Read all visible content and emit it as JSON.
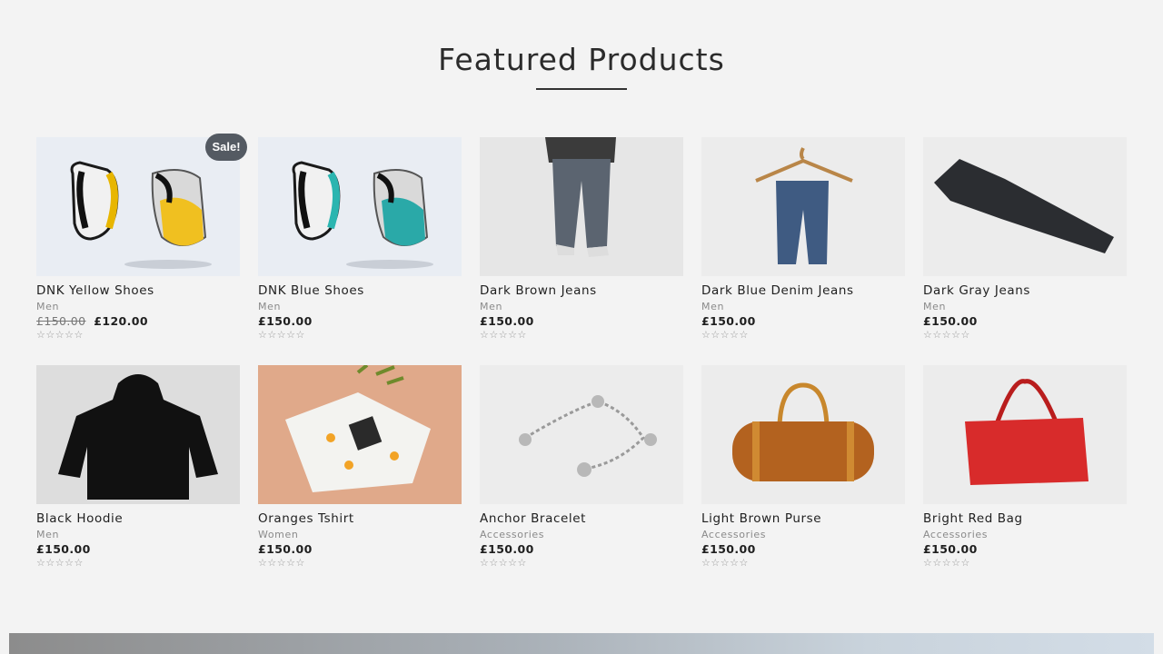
{
  "section": {
    "title": "Featured Products"
  },
  "products": [
    {
      "name": "DNK Yellow Shoes",
      "category": "Men",
      "price": "£120.00",
      "old_price": "£150.00",
      "badge": "Sale!",
      "stars": "☆☆☆☆☆",
      "image": "yellow-shoes-image"
    },
    {
      "name": "DNK Blue Shoes",
      "category": "Men",
      "price": "£150.00",
      "stars": "☆☆☆☆☆",
      "image": "blue-shoes-image"
    },
    {
      "name": "Dark Brown Jeans",
      "category": "Men",
      "price": "£150.00",
      "stars": "☆☆☆☆☆",
      "image": "brown-jeans-image"
    },
    {
      "name": "Dark Blue Denim Jeans",
      "category": "Men",
      "price": "£150.00",
      "stars": "☆☆☆☆☆",
      "image": "denim-jeans-image"
    },
    {
      "name": "Dark Gray Jeans",
      "category": "Men",
      "price": "£150.00",
      "stars": "☆☆☆☆☆",
      "image": "gray-jeans-image"
    },
    {
      "name": "Black Hoodie",
      "category": "Men",
      "price": "£150.00",
      "stars": "☆☆☆☆☆",
      "image": "hoodie-image"
    },
    {
      "name": "Oranges Tshirt",
      "category": "Women",
      "price": "£150.00",
      "stars": "☆☆☆☆☆",
      "image": "tshirt-image"
    },
    {
      "name": "Anchor Bracelet",
      "category": "Accessories",
      "price": "£150.00",
      "stars": "☆☆☆☆☆",
      "image": "bracelet-image"
    },
    {
      "name": "Light Brown Purse",
      "category": "Accessories",
      "price": "£150.00",
      "stars": "☆☆☆☆☆",
      "image": "purse-image"
    },
    {
      "name": "Bright Red Bag",
      "category": "Accessories",
      "price": "£150.00",
      "stars": "☆☆☆☆☆",
      "image": "red-bag-image"
    }
  ],
  "colors": {
    "background": "#f3f3f3",
    "badge": "#545a62",
    "text": "#1f1f1f",
    "muted": "#8a8a8a"
  }
}
